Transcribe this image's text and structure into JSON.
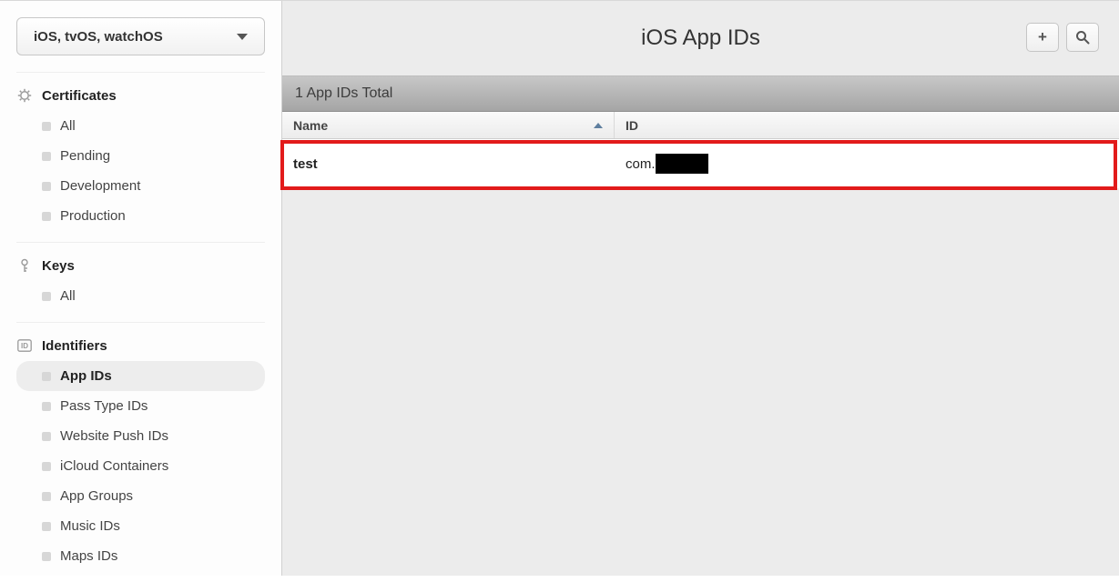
{
  "sidebar": {
    "platform_selector": "iOS, tvOS, watchOS",
    "sections": [
      {
        "title": "Certificates",
        "items": [
          "All",
          "Pending",
          "Development",
          "Production"
        ],
        "active_index": -1
      },
      {
        "title": "Keys",
        "items": [
          "All"
        ],
        "active_index": -1
      },
      {
        "title": "Identifiers",
        "items": [
          "App IDs",
          "Pass Type IDs",
          "Website Push IDs",
          "iCloud Containers",
          "App Groups",
          "Music IDs",
          "Maps IDs"
        ],
        "active_index": 0
      }
    ]
  },
  "main": {
    "title": "iOS App IDs",
    "count_label": "1 App IDs Total",
    "columns": {
      "name": "Name",
      "id": "ID"
    },
    "rows": [
      {
        "name": "test",
        "id_prefix": "com."
      }
    ]
  }
}
